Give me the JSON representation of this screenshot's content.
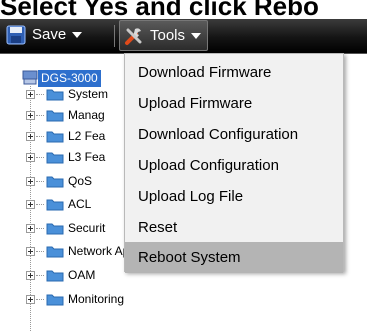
{
  "instruction": "Select Yes and click Rebo",
  "toolbar": {
    "save_label": "Save",
    "tools_label": "Tools"
  },
  "tree": {
    "root": "DGS-3000",
    "items": [
      {
        "label": "System"
      },
      {
        "label": "Manag"
      },
      {
        "label": "L2 Fea"
      },
      {
        "label": "L3 Fea"
      },
      {
        "label": "QoS"
      },
      {
        "label": "ACL"
      },
      {
        "label": "Securit"
      },
      {
        "label": "Network Application"
      },
      {
        "label": "OAM"
      },
      {
        "label": "Monitoring"
      }
    ]
  },
  "tools_menu": {
    "items": [
      {
        "label": "Download Firmware"
      },
      {
        "label": "Upload Firmware"
      },
      {
        "label": "Download Configuration"
      },
      {
        "label": "Upload Configuration"
      },
      {
        "label": "Upload Log File"
      },
      {
        "label": "Reset"
      },
      {
        "label": "Reboot System"
      }
    ],
    "highlighted": "Reboot System"
  },
  "colors": {
    "toolbar_bg": "#141414",
    "selection_blue": "#2d6fcd",
    "menu_bg": "#f1f1f1",
    "menu_highlight": "#b4b4b4"
  }
}
